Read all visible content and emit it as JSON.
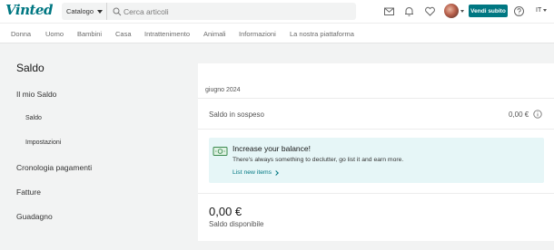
{
  "header": {
    "logo": "Vinted",
    "catalog_label": "Catalogo",
    "search_placeholder": "Cerca articoli",
    "sell_button": "Vendi subito",
    "language": "IT",
    "icons": [
      "mail-icon",
      "bell-icon",
      "heart-icon",
      "avatar",
      "help-icon"
    ]
  },
  "category_nav": [
    "Donna",
    "Uomo",
    "Bambini",
    "Casa",
    "Intrattenimento",
    "Animali",
    "Informazioni",
    "La nostra piattaforma"
  ],
  "sidebar": {
    "title": "Saldo",
    "items": [
      {
        "label": "Il mio Saldo"
      },
      {
        "label": "Saldo"
      },
      {
        "label": "Impostazioni"
      },
      {
        "label": "Cronologia pagamenti"
      },
      {
        "label": "Fatture"
      },
      {
        "label": "Guadagno"
      }
    ]
  },
  "main": {
    "month": "giugno 2024",
    "pending_label": "Saldo in sospeso",
    "pending_value": "0,00 €",
    "promo": {
      "title": "Increase your balance!",
      "text": "There's always something to declutter, go list it and earn more.",
      "link": "List new items"
    },
    "balance_value": "0,00 €",
    "balance_label": "Saldo disponibile"
  },
  "colors": {
    "brand": "#007782",
    "promo_bg": "#e6f6f7",
    "page_bg": "#f2f3f3"
  }
}
